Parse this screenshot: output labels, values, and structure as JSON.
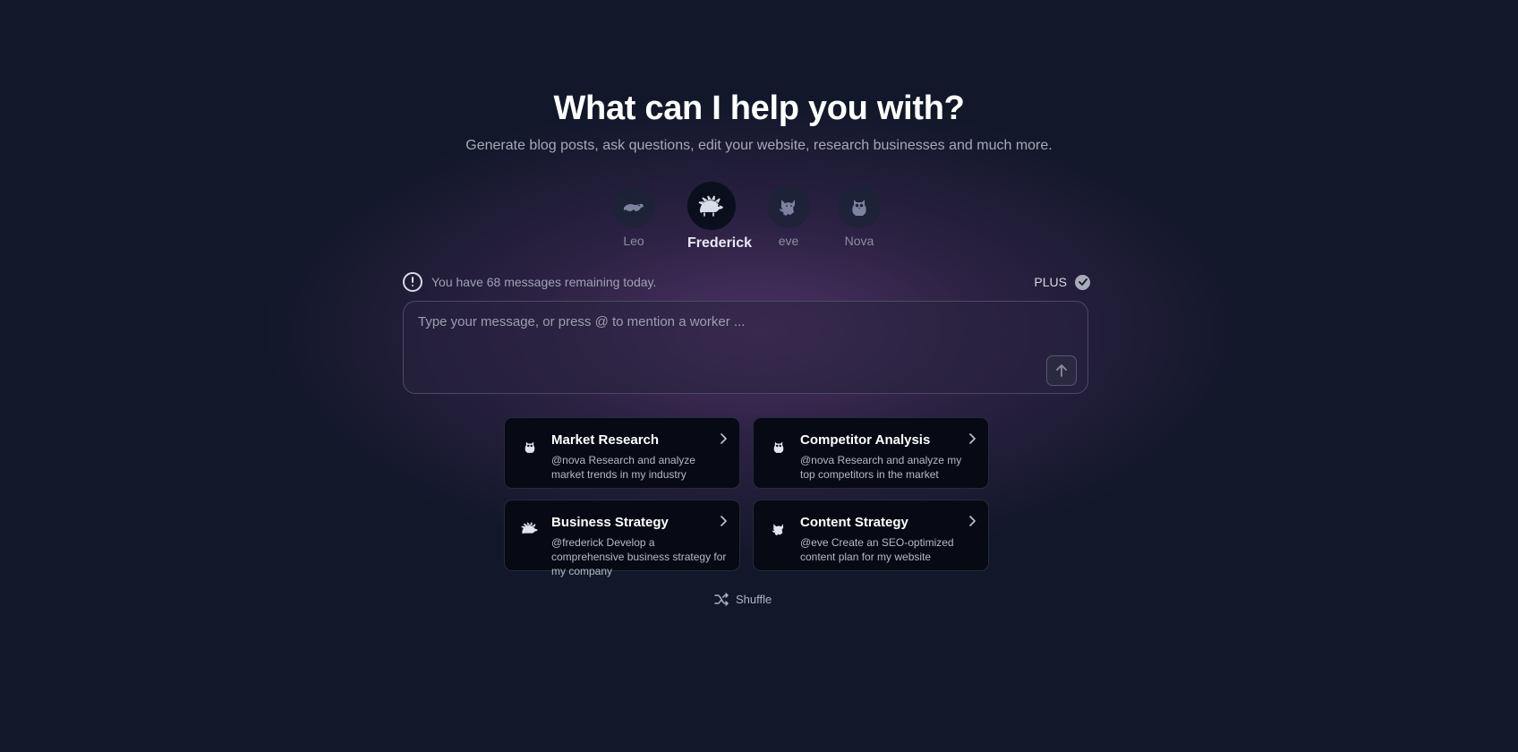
{
  "hero": {
    "title": "What can I help you with?",
    "subtitle": "Generate blog posts, ask questions, edit your website, research businesses and much more."
  },
  "workers": [
    {
      "name": "Leo",
      "icon": "platypus-icon",
      "active": false
    },
    {
      "name": "Frederick",
      "icon": "hedgehog-icon",
      "active": true
    },
    {
      "name": "eve",
      "icon": "fox-icon",
      "active": false
    },
    {
      "name": "Nova",
      "icon": "owl-icon",
      "active": false
    }
  ],
  "status": {
    "limit_text": "You have 68 messages remaining today.",
    "plan": "PLUS"
  },
  "composer": {
    "placeholder": "Type your message, or press @ to mention a worker ...",
    "value": ""
  },
  "suggestions": [
    {
      "title": "Market Research",
      "description": "@nova Research and analyze market trends in my industry",
      "icon": "owl-icon"
    },
    {
      "title": "Competitor Analysis",
      "description": "@nova Research and analyze my top competitors in the market",
      "icon": "owl-icon"
    },
    {
      "title": "Business Strategy",
      "description": "@frederick Develop a comprehensive business strategy for my company",
      "icon": "hedgehog-icon"
    },
    {
      "title": "Content Strategy",
      "description": "@eve Create an SEO-optimized content plan for my website",
      "icon": "fox-icon"
    }
  ],
  "shuffle_label": "Shuffle",
  "colors": {
    "background": "#121729",
    "glow": "#70448a",
    "card": "#070914"
  }
}
